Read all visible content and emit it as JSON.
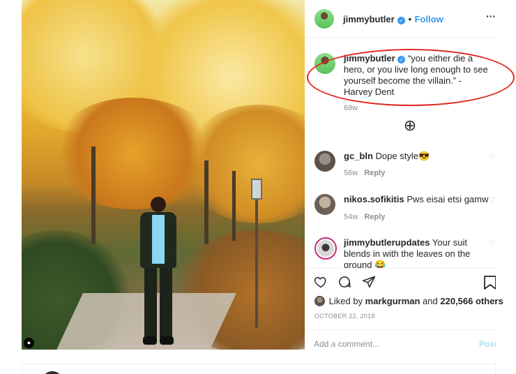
{
  "post": {
    "username": "jimmybutler",
    "follow_label": "Follow",
    "separator": "•",
    "more_label": "···"
  },
  "caption": {
    "username": "jimmybutler",
    "text": "“you either die a hero, or you live long enough to see yourself become the villain.” - Harvey Dent",
    "time": "68w"
  },
  "load_more_label": "⊕",
  "comments": [
    {
      "username": "gc_bln",
      "text": "Dope style😎",
      "time": "56w",
      "reply": "Reply"
    },
    {
      "username": "nikos.sofikitis",
      "text": "Pws eisai etsi gamw",
      "time": "54w",
      "reply": "Reply"
    },
    {
      "username": "jimmybutlerupdates",
      "text": "Your suit blends in with the leaves on the ground 😂",
      "time": "",
      "reply": ""
    }
  ],
  "likes": {
    "prefix": "Liked by",
    "user": "markgurman",
    "and": "and",
    "count": "220,566 others"
  },
  "date": "OCTOBER 22, 2018",
  "add_comment": {
    "placeholder": "Add a comment...",
    "post_label": "Post"
  },
  "colors": {
    "link": "#3897f0",
    "annotation": "#e0261e",
    "muted": "#8e8e8e"
  }
}
